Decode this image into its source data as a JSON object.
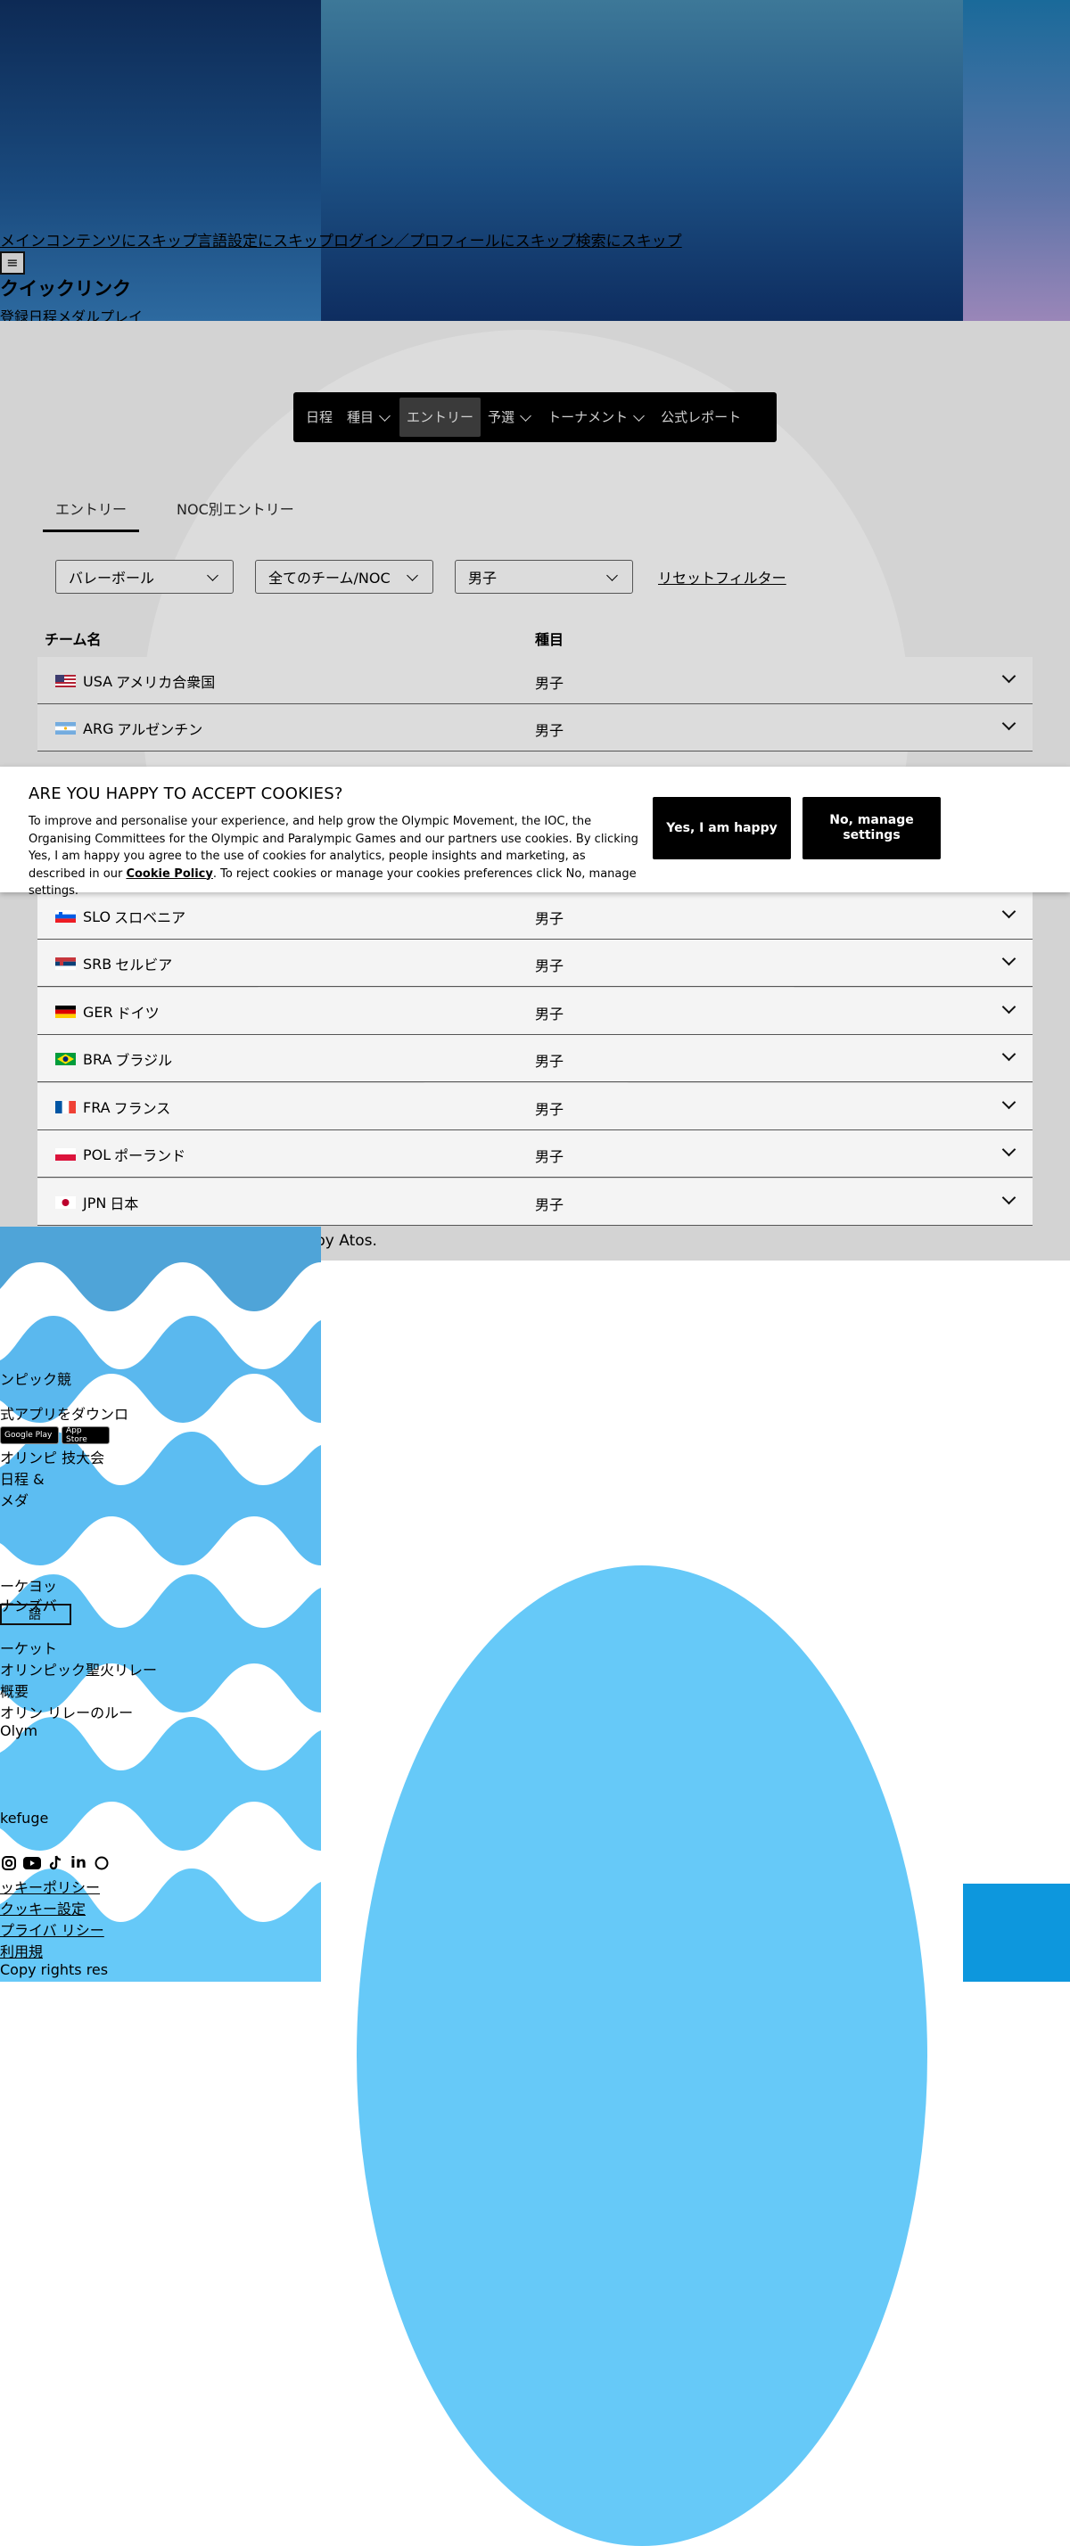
{
  "skip_links": [
    "メインコンテンツにスキップ",
    "言語設定にスキップ",
    "ログイン／プロフィールにスキップ",
    "検索にスキップ"
  ],
  "menu_button": "≡",
  "quick_links": {
    "title": "クイックリンク",
    "items": [
      "登録",
      "日程",
      "メダル",
      "プレイ"
    ]
  },
  "nav": {
    "items": [
      {
        "label": "日程",
        "has_menu": false
      },
      {
        "label": "種目",
        "has_menu": true
      },
      {
        "label": "エントリー",
        "has_menu": false,
        "active": true
      },
      {
        "label": "予選",
        "has_menu": true
      },
      {
        "label": "トーナメント",
        "has_menu": true
      },
      {
        "label": "公式レポート",
        "has_menu": false
      }
    ]
  },
  "tabs": [
    {
      "label": "エントリー",
      "active": true
    },
    {
      "label": "NOC別エントリー",
      "active": false
    }
  ],
  "filters": {
    "sport": "バレーボール",
    "noc": "全てのチーム/NOC",
    "gender": "男子",
    "reset": "リセットフィルター"
  },
  "table": {
    "col_team": "チーム名",
    "col_event": "種目",
    "rows": [
      {
        "code": "USA",
        "name": "アメリカ合衆国",
        "event": "男子",
        "flag": "usa"
      },
      {
        "code": "ARG",
        "name": "アルゼンチン",
        "event": "男子",
        "flag": "arg"
      },
      {
        "code": "SLO",
        "name": "スロベニア",
        "event": "男子",
        "flag": "slo"
      },
      {
        "code": "SRB",
        "name": "セルビア",
        "event": "男子",
        "flag": "srb"
      },
      {
        "code": "GER",
        "name": "ドイツ",
        "event": "男子",
        "flag": "ger"
      },
      {
        "code": "BRA",
        "name": "ブラジル",
        "event": "男子",
        "flag": "bra"
      },
      {
        "code": "FRA",
        "name": "フランス",
        "event": "男子",
        "flag": "fra"
      },
      {
        "code": "POL",
        "name": "ポーランド",
        "event": "男子",
        "flag": "pol"
      },
      {
        "code": "JPN",
        "name": "日本",
        "event": "男子",
        "flag": "jpn"
      }
    ]
  },
  "scoring_note": "T        scoring provi          GA. Results powered by Atos.",
  "cookie": {
    "title": "ARE YOU HAPPY TO ACCEPT COOKIES?",
    "body": "To improve and personalise your experience, and help grow the Olympic Movement, the IOC, the Organising Committees for the Olympic and Paralympic Games and our partners use cookies. By clicking Yes, I am happy you agree to the use of cookies for analytics, people insights and marketing, as described in our",
    "link": "Cookie Policy",
    "body_end": ". To reject cookies or manage your cookies preferences click No, manage settings.",
    "accept": "Yes, I am happy",
    "manage": "No, manage settings"
  },
  "footer": {
    "lines": [
      "ンピック競",
      "式アプリをダウンロ",
      "オリンピ     技大会",
      "日程 &",
      "メダ",
      "ーケヨッ",
      "  ナンズバ",
      "ーケット",
      "オリンピック聖火リレー",
      "概要",
      "オリン      リレーのルー",
      "Olym",
      "kefuge",
      "ッキーポリシー",
      "クッキー設定",
      "プライバ      リシー",
      "利用規",
      "Copy          rights res"
    ],
    "store_google": "Google Play",
    "store_apple": "App Store",
    "lang": "語"
  },
  "colors": {
    "nav_bg": "#000000",
    "nav_active": "#3a3a3a",
    "footer_wave": "#4fa4d8",
    "footer_blob": "#66c9f8"
  }
}
